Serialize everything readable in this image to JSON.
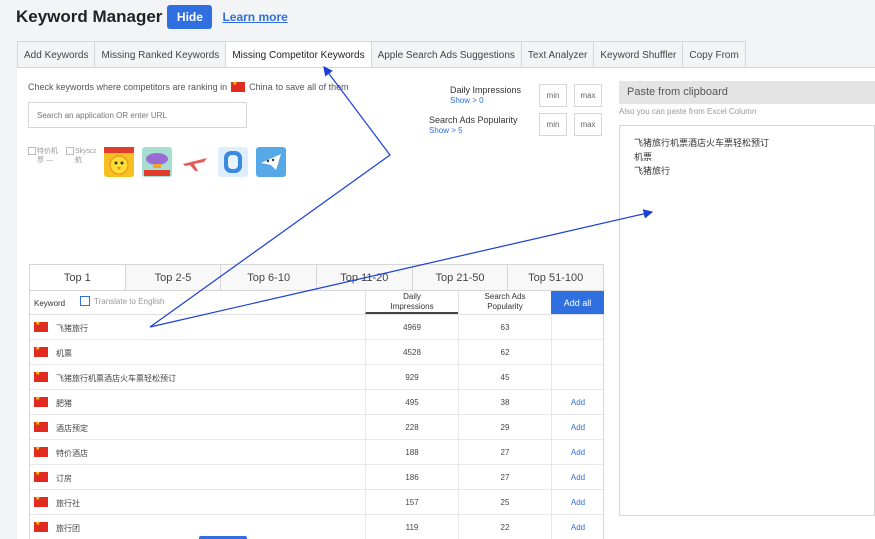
{
  "header": {
    "title": "Keyword Manager",
    "hide_label": "Hide",
    "learn_more_label": "Learn more"
  },
  "tabs": [
    {
      "label": "Add Keywords"
    },
    {
      "label": "Missing Ranked Keywords"
    },
    {
      "label": "Missing Competitor Keywords"
    },
    {
      "label": "Apple Search Ads Suggestions"
    },
    {
      "label": "Text Analyzer"
    },
    {
      "label": "Keyword Shuffler"
    },
    {
      "label": "Copy From"
    }
  ],
  "competitor": {
    "check_text_before": "Check keywords where competitors are ranking in",
    "country": "China",
    "check_text_after": "to save all of them",
    "search_placeholder": "Search an application OR enter URL"
  },
  "filters": {
    "impressions_label": "Daily Impressions",
    "impressions_sub": "Show > 0",
    "popularity_label": "Search Ads Popularity",
    "popularity_sub": "Show > 5",
    "min_label": "min",
    "max_label": "max"
  },
  "apps": [
    {
      "alt": "特价机票 —"
    },
    {
      "alt": "Skyscanner 航"
    },
    {
      "icon": "chick-app-icon",
      "color": "#f6c021"
    },
    {
      "icon": "blimp-app-icon",
      "color": "#7bc8b8"
    },
    {
      "icon": "plane-app-icon",
      "color": "#ffffff"
    },
    {
      "icon": "phone-app-icon",
      "color": "#3a8be0"
    },
    {
      "icon": "paperplane-app-icon",
      "color": "#56a9e6"
    }
  ],
  "rank_tabs": [
    {
      "label": "Top 1"
    },
    {
      "label": "Top 2-5"
    },
    {
      "label": "Top 6-10"
    },
    {
      "label": "Top 11-20"
    },
    {
      "label": "Top 21-50"
    },
    {
      "label": "Top 51-100"
    }
  ],
  "table": {
    "keyword_header": "Keyword",
    "translate_label": "Translate to English",
    "impressions_header_1": "Daily",
    "impressions_header_2": "Impressions",
    "popularity_header_1": "Search Ads",
    "popularity_header_2": "Popularity",
    "add_all_label": "Add all",
    "rows": [
      {
        "keyword": "飞猪旅行",
        "impressions": "4969",
        "popularity": "63",
        "add": ""
      },
      {
        "keyword": "机票",
        "impressions": "4528",
        "popularity": "62",
        "add": ""
      },
      {
        "keyword": "飞猪旅行机票酒店火车票轻松预订",
        "impressions": "929",
        "popularity": "45",
        "add": ""
      },
      {
        "keyword": "肥猪",
        "impressions": "495",
        "popularity": "38",
        "add": "Add"
      },
      {
        "keyword": "酒店预定",
        "impressions": "228",
        "popularity": "29",
        "add": "Add"
      },
      {
        "keyword": "特价酒店",
        "impressions": "188",
        "popularity": "27",
        "add": "Add"
      },
      {
        "keyword": "订房",
        "impressions": "186",
        "popularity": "27",
        "add": "Add"
      },
      {
        "keyword": "旅行社",
        "impressions": "157",
        "popularity": "25",
        "add": "Add"
      },
      {
        "keyword": "旅行团",
        "impressions": "119",
        "popularity": "22",
        "add": "Add"
      }
    ]
  },
  "paste": {
    "button_label": "Paste from clipboard",
    "hint": "Also you can paste from Excel Column",
    "lines": [
      "飞猪旅行机票酒店火车票轻松预订",
      "机票",
      "飞猪旅行"
    ]
  },
  "colors": {
    "accent": "#2f6fdf",
    "flag_red": "#e12a20",
    "arrow": "#1a3fd6"
  }
}
